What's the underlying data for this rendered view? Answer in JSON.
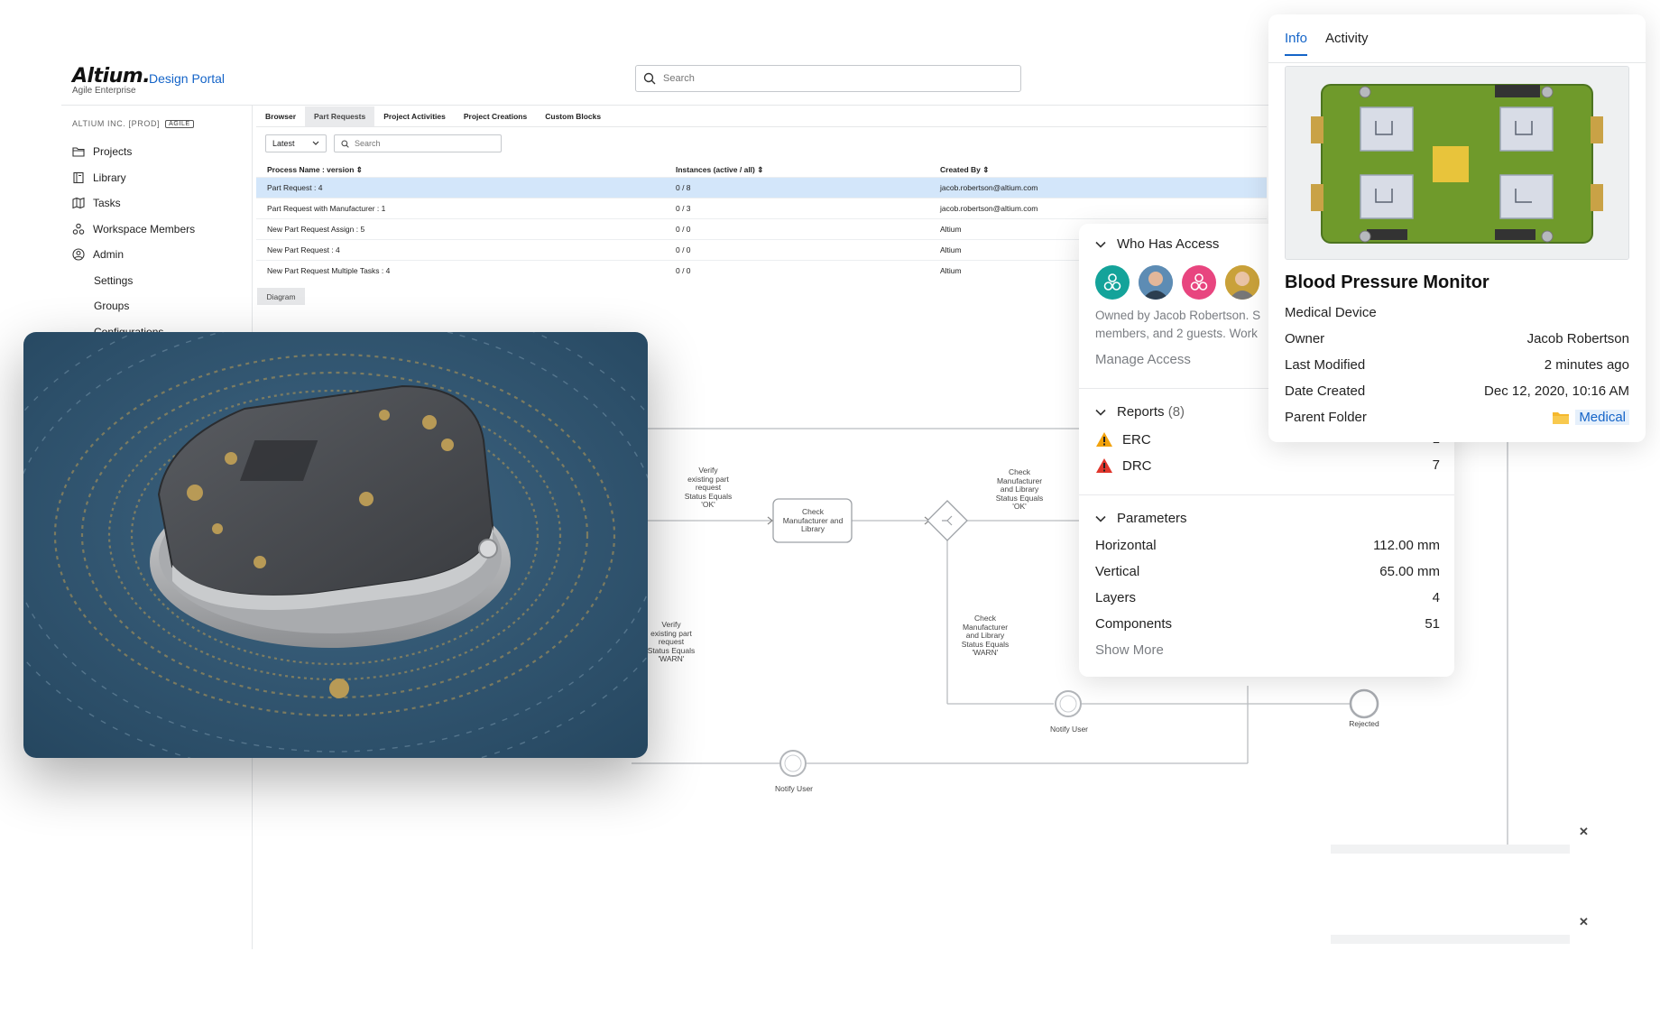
{
  "header": {
    "logo_text": "Altium.",
    "logo_subtitle": "Agile Enterprise",
    "portal_title": "Design Portal",
    "search_placeholder": "Search"
  },
  "sidebar": {
    "org_name": "ALTIUM INC. [PROD]",
    "org_tag": "AGILE",
    "items": [
      {
        "label": "Projects",
        "icon": "folder-icon"
      },
      {
        "label": "Library",
        "icon": "library-icon"
      },
      {
        "label": "Tasks",
        "icon": "tasks-icon"
      },
      {
        "label": "Workspace Members",
        "icon": "members-icon"
      },
      {
        "label": "Admin",
        "icon": "admin-icon"
      }
    ],
    "sub_items": [
      "Settings",
      "Groups",
      "Configurations"
    ]
  },
  "tabs": [
    "Browser",
    "Part Requests",
    "Project Activities",
    "Project Creations",
    "Custom Blocks"
  ],
  "active_tab": "Part Requests",
  "filter": {
    "version": "Latest",
    "search_placeholder": "Search"
  },
  "table": {
    "headers": [
      "Process Name : version",
      "Instances (active / all)",
      "Created By"
    ],
    "rows": [
      [
        "Part Request : 4",
        "0 / 8",
        "jacob.robertson@altium.com"
      ],
      [
        "Part Request with Manufacturer : 1",
        "0 / 3",
        "jacob.robertson@altium.com"
      ],
      [
        "New Part Request Assign : 5",
        "0 / 0",
        "Altium"
      ],
      [
        "New Part Request : 4",
        "0 / 0",
        "Altium"
      ],
      [
        "New Part Request Multiple Tasks : 4",
        "0 / 0",
        "Altium"
      ]
    ]
  },
  "diagram": {
    "tab": "Diagram",
    "labels": {
      "verify_ok": "Verify\nexisting part\nrequest\nStatus Equals\n'OK'",
      "check_box": "Check\nManufacturer and\nLibrary",
      "check_ok": "Check\nManufacturer\nand Library\nStatus Equals\n'OK'",
      "verify_warn": "Verify\nexisting part\nrequest\nStatus Equals\n'WARN'",
      "check_warn": "Check\nManufacturer\nand Library\nStatus Equals\n'WARN'",
      "notify_user_1": "Notify User",
      "notify_user_2": "Notify User",
      "rejected": "Rejected"
    }
  },
  "access_panel": {
    "who_has_access": "Who Has Access",
    "owned_by_line1": "Owned by Jacob Robertson. S",
    "owned_by_line2": "members, and 2 guests. Work",
    "manage_access": "Manage Access",
    "reports_title": "Reports",
    "reports_count": "(8)",
    "reports": [
      {
        "name": "ERC",
        "value": "1",
        "icon": "warning-icon",
        "color": "#f2a20c"
      },
      {
        "name": "DRC",
        "value": "7",
        "icon": "error-icon",
        "color": "#e0352b"
      }
    ],
    "parameters_title": "Parameters",
    "parameters": [
      {
        "name": "Horizontal",
        "value": "112.00 mm"
      },
      {
        "name": "Vertical",
        "value": "65.00 mm"
      },
      {
        "name": "Layers",
        "value": "4"
      },
      {
        "name": "Components",
        "value": "51"
      }
    ],
    "show_more": "Show More"
  },
  "info_panel": {
    "tabs": [
      "Info",
      "Activity"
    ],
    "active_tab": "Info",
    "title": "Blood Pressure Monitor",
    "subtitle": "Medical Device",
    "rows": [
      {
        "label": "Owner",
        "value": "Jacob Robertson"
      },
      {
        "label": "Last Modified",
        "value": "2 minutes ago"
      },
      {
        "label": "Date Created",
        "value": "Dec 12, 2020, 10:16 AM"
      },
      {
        "label": "Parent Folder",
        "value": "Medical"
      }
    ]
  },
  "colors": {
    "accent": "#1464c8",
    "selected_row": "#d3e6fa",
    "avatar_teal": "#14a39a",
    "avatar_pink": "#e8457f",
    "pcb_green": "#6f9a2b"
  }
}
